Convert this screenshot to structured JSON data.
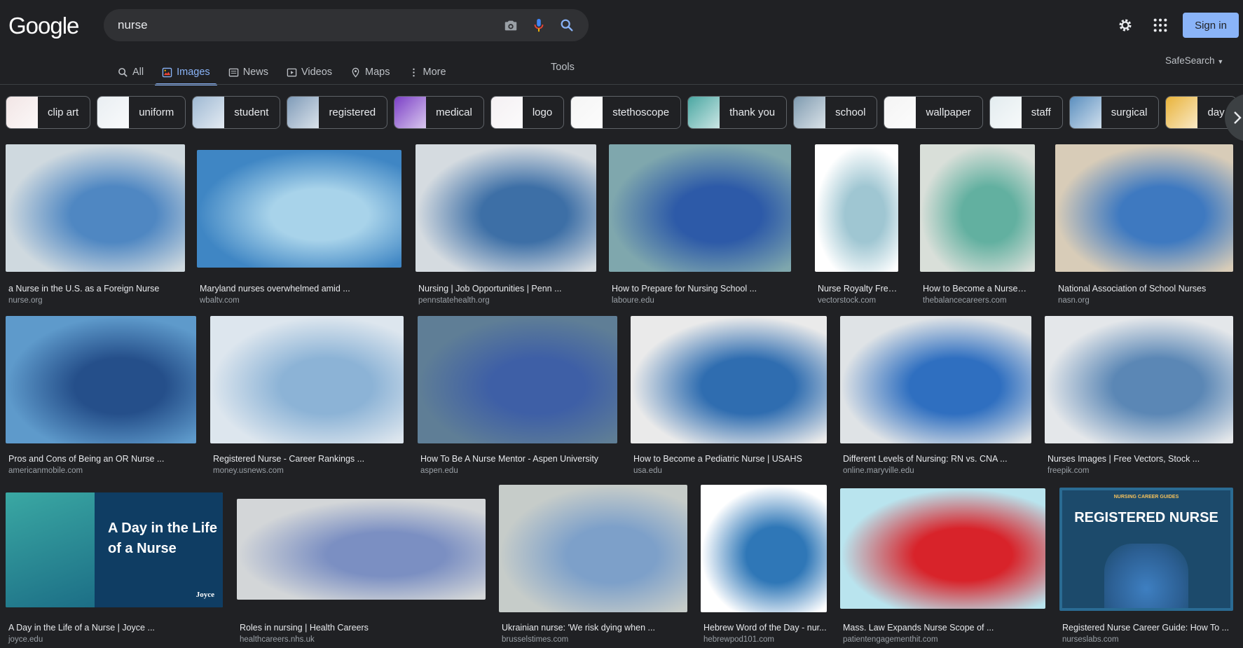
{
  "header": {
    "logo": "Google",
    "query": "nurse",
    "signin_label": "Sign in"
  },
  "nav": {
    "tabs": [
      {
        "label": "All",
        "icon": "search-icon"
      },
      {
        "label": "Images",
        "icon": "image-icon",
        "active": true
      },
      {
        "label": "News",
        "icon": "news-icon"
      },
      {
        "label": "Videos",
        "icon": "video-icon"
      },
      {
        "label": "Maps",
        "icon": "map-pin-icon"
      },
      {
        "label": "More",
        "icon": "more-vert-icon"
      }
    ],
    "tools_label": "Tools",
    "safesearch_label": "SafeSearch"
  },
  "chips": [
    {
      "label": "clip art",
      "color": "#f2e6e6"
    },
    {
      "label": "uniform",
      "color": "#e9eef2"
    },
    {
      "label": "student",
      "color": "#9fb9d3"
    },
    {
      "label": "registered",
      "color": "#7f9bb8"
    },
    {
      "label": "medical",
      "color": "#7b3fc6"
    },
    {
      "label": "logo",
      "color": "#f4f0f3"
    },
    {
      "label": "stethoscope",
      "color": "#f5f5f5"
    },
    {
      "label": "thank you",
      "color": "#4aa7a2"
    },
    {
      "label": "school",
      "color": "#7f9bb0"
    },
    {
      "label": "wallpaper",
      "color": "#f4f4f4"
    },
    {
      "label": "staff",
      "color": "#e3ecef"
    },
    {
      "label": "surgical",
      "color": "#5b8fbf"
    },
    {
      "label": "day",
      "color": "#e9b33a"
    }
  ],
  "results": [
    {
      "title": "a Nurse in the U.S. as a Foreign Nurse",
      "site": "nurse.org",
      "c1": "#cfd9df",
      "c2": "#4f87c2"
    },
    {
      "title": "Maryland nurses overwhelmed amid ...",
      "site": "wbaltv.com",
      "c1": "#3f86c4",
      "c2": "#a8d3ea"
    },
    {
      "title": "Nursing | Job Opportunities | Penn ...",
      "site": "pennstatehealth.org",
      "c1": "#d5dbe0",
      "c2": "#3d6fa6"
    },
    {
      "title": "How to Prepare for Nursing School ...",
      "site": "laboure.edu",
      "c1": "#7fa7ad",
      "c2": "#2d5aa8"
    },
    {
      "title": "Nurse Royalty Free Vec...",
      "site": "vectorstock.com",
      "c1": "#ffffff",
      "c2": "#9fc6d2"
    },
    {
      "title": "How to Become a Nurse—E...",
      "site": "thebalancecareers.com",
      "c1": "#d9dfd9",
      "c2": "#62b0a0"
    },
    {
      "title": "National Association of School Nurses",
      "site": "nasn.org",
      "c1": "#d8ccb8",
      "c2": "#3e79c0"
    },
    {
      "title": "Pros and Cons of Being an OR Nurse ...",
      "site": "americanmobile.com",
      "c1": "#5e9acb",
      "c2": "#254f8a"
    },
    {
      "title": "Registered Nurse - Career Rankings ...",
      "site": "money.usnews.com",
      "c1": "#dde6ee",
      "c2": "#8cb3d6"
    },
    {
      "title": "How To Be A Nurse Mentor - Aspen University",
      "site": "aspen.edu",
      "c1": "#5f7e96",
      "c2": "#3e5fa6"
    },
    {
      "title": "How to Become a Pediatric Nurse | USAHS",
      "site": "usa.edu",
      "c1": "#eaeaea",
      "c2": "#2f6db0"
    },
    {
      "title": "Different Levels of Nursing: RN vs. CNA ...",
      "site": "online.maryville.edu",
      "c1": "#dfe3e6",
      "c2": "#2f6fc0"
    },
    {
      "title": "Nurses Images | Free Vectors, Stock ...",
      "site": "freepik.com",
      "c1": "#e4e7ea",
      "c2": "#5b87b5"
    },
    {
      "title": "A Day in the Life of a Nurse | Joyce ...",
      "site": "joyce.edu",
      "c1": "#2e9a9e",
      "c2": "#0f3d63",
      "overlay": [
        "A Day in the Life",
        "of a Nurse",
        "Joyce"
      ]
    },
    {
      "title": "Roles in nursing | Health Careers",
      "site": "healthcareers.nhs.uk",
      "c1": "#d3d6d8",
      "c2": "#7b8fc2"
    },
    {
      "title": "Ukrainian nurse: 'We risk dying when ...",
      "site": "brusselstimes.com",
      "c1": "#c6ccc9",
      "c2": "#7da0c9"
    },
    {
      "title": "Hebrew Word of the Day - nur...",
      "site": "hebrewpod101.com",
      "c1": "#ffffff",
      "c2": "#2f77b7"
    },
    {
      "title": "Mass. Law Expands Nurse Scope of ...",
      "site": "patientengagementhit.com",
      "c1": "#b9e4ee",
      "c2": "#d8232a"
    },
    {
      "title": "Registered Nurse Career Guide: How To ...",
      "site": "nurseslabs.com",
      "c1": "#1c4a6b",
      "c2": "#2a6b93",
      "overlay": [
        "NURSING CAREER GUIDES",
        "REGISTERED NURSE"
      ]
    }
  ]
}
